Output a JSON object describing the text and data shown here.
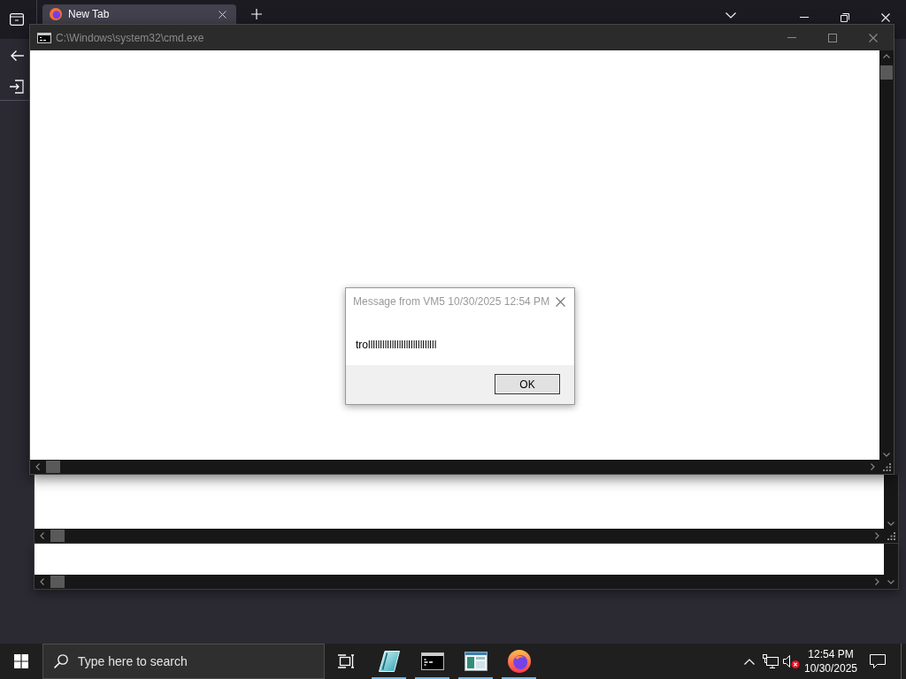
{
  "browser": {
    "tabs": [
      {
        "label": "New Tab",
        "selected": true
      }
    ]
  },
  "console_window": {
    "title": "C:\\Windows\\system32\\cmd.exe",
    "active": false
  },
  "message_box": {
    "title": "Message from VM5 10/30/2025 12:54 PM",
    "message": "trolllllllllllllllllllllllllllll",
    "buttons": [
      "OK"
    ]
  },
  "taskbar": {
    "search": {
      "placeholder": "Type here to search"
    },
    "apps": [
      {
        "kind": "tile",
        "running": true
      },
      {
        "kind": "console",
        "running": true
      },
      {
        "kind": "window",
        "running": true
      },
      {
        "kind": "browser",
        "running": true
      }
    ],
    "tray": {
      "muted": true
    },
    "clock": {
      "time": "12:54 PM",
      "date": "10/30/2025"
    }
  }
}
